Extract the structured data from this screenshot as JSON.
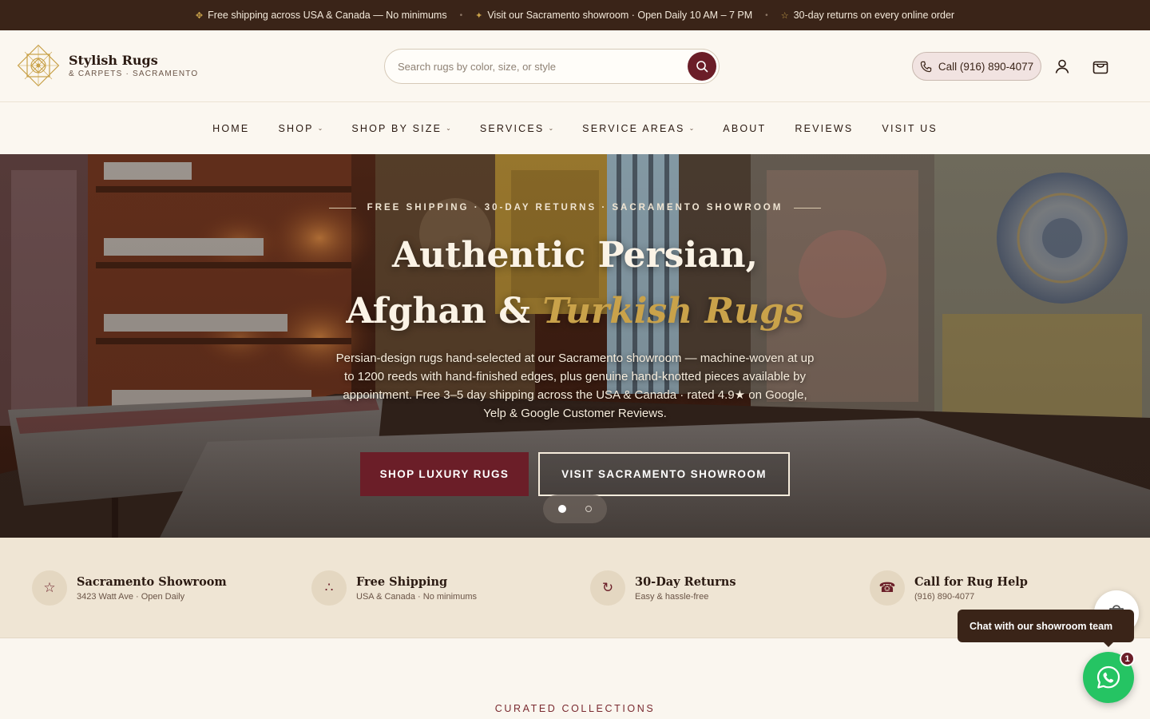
{
  "announcement": {
    "items": [
      {
        "glyph": "✥",
        "text": "Free shipping across USA & Canada — No minimums"
      },
      {
        "glyph": "✦",
        "text": "Visit our Sacramento showroom · Open Daily 10 AM – 7 PM"
      },
      {
        "glyph": "☆",
        "text": "30-day returns on every online order"
      }
    ],
    "separator": "•"
  },
  "header": {
    "brand_name": "Stylish Rugs",
    "brand_sub": "& CARPETS · SACRAMENTO",
    "search_placeholder": "Search rugs by color, size, or style",
    "call_label": "Call (916) 890-4077",
    "icons": [
      "search-icon",
      "phone-icon",
      "account-icon",
      "cart-icon"
    ]
  },
  "nav": {
    "items": [
      {
        "label": "HOME",
        "has_dropdown": false
      },
      {
        "label": "SHOP",
        "has_dropdown": true
      },
      {
        "label": "SHOP BY SIZE",
        "has_dropdown": true
      },
      {
        "label": "SERVICES",
        "has_dropdown": true
      },
      {
        "label": "SERVICE AREAS",
        "has_dropdown": true
      },
      {
        "label": "ABOUT",
        "has_dropdown": false
      },
      {
        "label": "REVIEWS",
        "has_dropdown": false
      },
      {
        "label": "VISIT US",
        "has_dropdown": false
      }
    ],
    "chevron": "⌄"
  },
  "hero": {
    "eyebrow": "FREE SHIPPING · 30-DAY RETURNS · SACRAMENTO SHOWROOM",
    "headline_line1": "Authentic Persian,",
    "headline_line2_a": "Afghan & ",
    "headline_line2_b": "Turkish Rugs",
    "description": "Persian-design rugs hand-selected at our Sacramento showroom — machine-woven at up to 1200 reeds with hand-finished edges, plus genuine hand-knotted pieces available by appointment. Free 3–5 day shipping across the USA & Canada · rated 4.9★ on Google, Yelp & Google Customer Reviews.",
    "cta_primary": "SHOP LUXURY RUGS",
    "cta_secondary": "VISIT SACRAMENTO SHOWROOM",
    "slides_total": 2,
    "slide_active": 1
  },
  "trust": {
    "items": [
      {
        "icon": "star-icon",
        "glyph": "☆",
        "title": "Sacramento Showroom",
        "sub": "3423 Watt Ave · Open Daily"
      },
      {
        "icon": "shipping-icon",
        "glyph": "∴",
        "title": "Free Shipping",
        "sub": "USA & Canada · No minimums"
      },
      {
        "icon": "returns-icon",
        "glyph": "↻",
        "title": "30-Day Returns",
        "sub": "Easy & hassle-free"
      },
      {
        "icon": "phone-icon",
        "glyph": "☎",
        "title": "Call for Rug Help",
        "sub": "(916) 890-4077"
      }
    ]
  },
  "collections": {
    "label": "CURATED COLLECTIONS"
  },
  "chat": {
    "bubble_text": "Chat with our showroom team",
    "unread_count": "1"
  },
  "colors": {
    "accent": "#6b1e28",
    "dark": "#3a2418",
    "gold": "#c9a24a",
    "cream": "#faf6ef",
    "whatsapp": "#25c463"
  }
}
